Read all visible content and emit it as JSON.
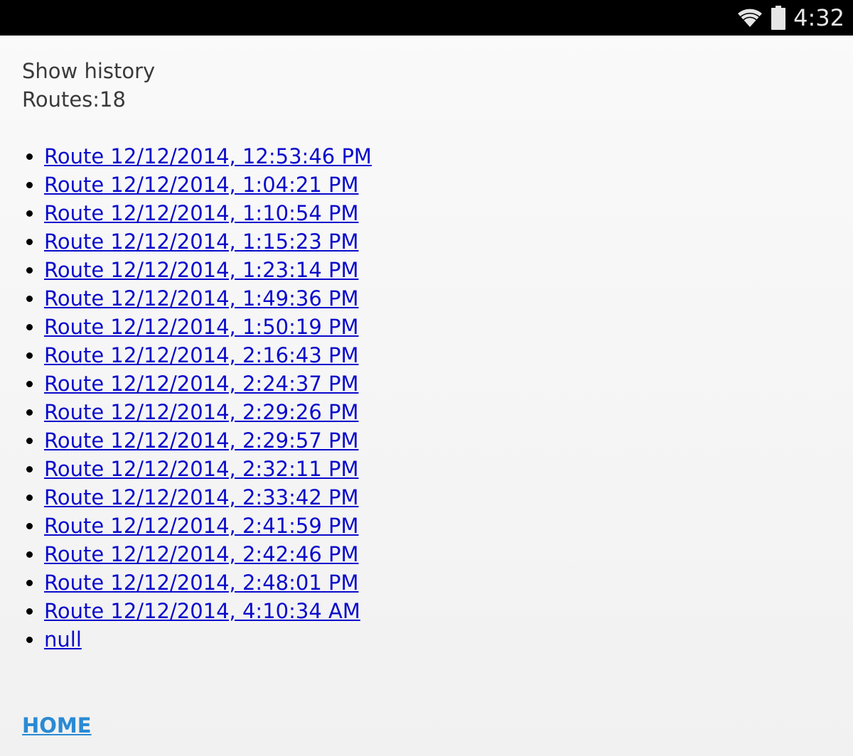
{
  "status_bar": {
    "time": "4:32",
    "icons": [
      "wifi-icon",
      "battery-icon"
    ]
  },
  "page": {
    "title": "Show history",
    "routes_count": "Routes:18"
  },
  "routes": [
    "Route 12/12/2014, 12:53:46 PM",
    "Route 12/12/2014, 1:04:21 PM",
    "Route 12/12/2014, 1:10:54 PM",
    "Route 12/12/2014, 1:15:23 PM",
    "Route 12/12/2014, 1:23:14 PM",
    "Route 12/12/2014, 1:49:36 PM",
    "Route 12/12/2014, 1:50:19 PM",
    "Route 12/12/2014, 2:16:43 PM",
    "Route 12/12/2014, 2:24:37 PM",
    "Route 12/12/2014, 2:29:26 PM",
    "Route 12/12/2014, 2:29:57 PM",
    "Route 12/12/2014, 2:32:11 PM",
    "Route 12/12/2014, 2:33:42 PM",
    "Route 12/12/2014, 2:41:59 PM",
    "Route 12/12/2014, 2:42:46 PM",
    "Route 12/12/2014, 2:48:01 PM",
    "Route 12/12/2014, 4:10:34 AM",
    "null"
  ],
  "footer": {
    "home_label": "HOME"
  },
  "colors": {
    "link": "#0a0acc",
    "home_link": "#2a8ad4",
    "status_bar_bg": "#000000"
  }
}
